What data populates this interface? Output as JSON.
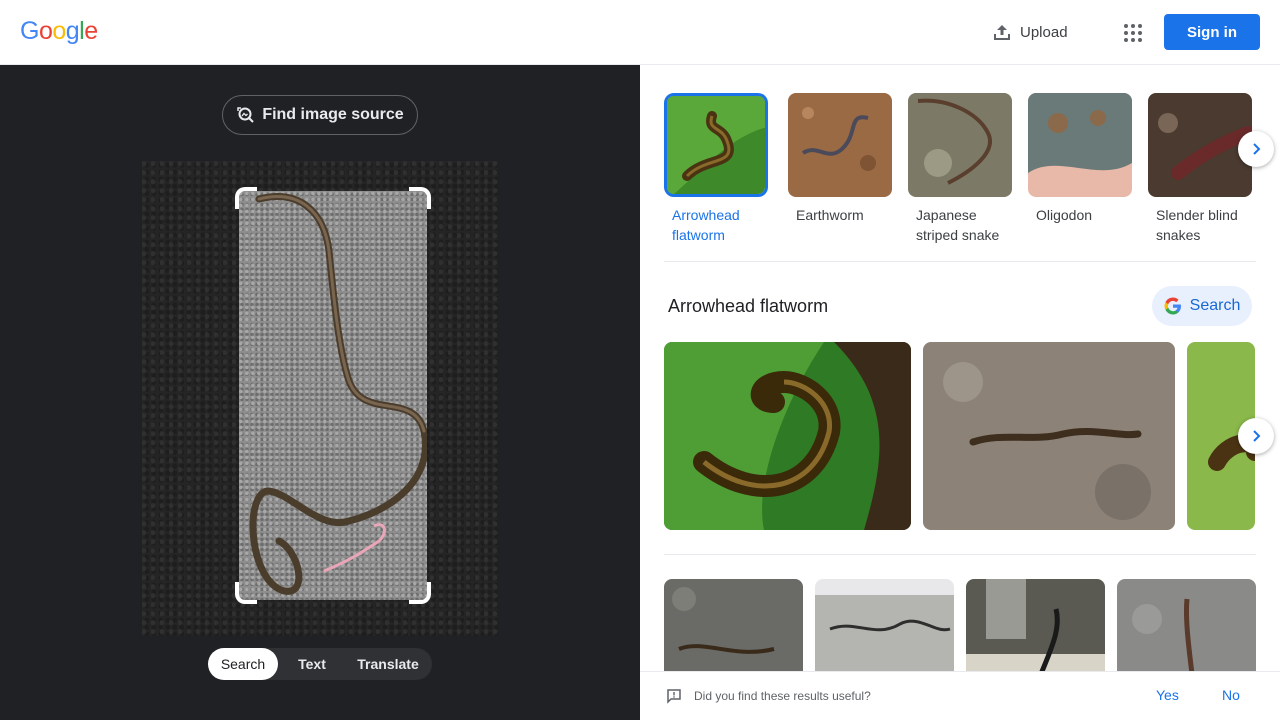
{
  "header": {
    "logo": [
      "G",
      "o",
      "o",
      "g",
      "l",
      "e"
    ],
    "logo_colors": [
      "#4285f4",
      "#ea4335",
      "#fbbc05",
      "#4285f4",
      "#34a853",
      "#ea4335"
    ],
    "upload_label": "Upload",
    "apps_icon": "apps-grid-icon",
    "signin_label": "Sign in"
  },
  "left": {
    "find_source_label": "Find image source",
    "modes": [
      "Search",
      "Text",
      "Translate"
    ],
    "active_mode": "Search"
  },
  "right": {
    "entities": [
      {
        "label": "Arrowhead flatworm",
        "selected": true
      },
      {
        "label": "Earthworm",
        "selected": false
      },
      {
        "label": "Japanese striped snake",
        "selected": false
      },
      {
        "label": "Oligodon",
        "selected": false
      },
      {
        "label": "Slender blind snakes",
        "selected": false
      }
    ],
    "section_title": "Arrowhead flatworm",
    "search_button_label": "Search",
    "feedback": {
      "question": "Did you find these results useful?",
      "yes": "Yes",
      "no": "No"
    }
  },
  "colors": {
    "accent": "#1a73e8",
    "dark_bg": "#202124",
    "chip_bg": "#e8f0fe"
  }
}
